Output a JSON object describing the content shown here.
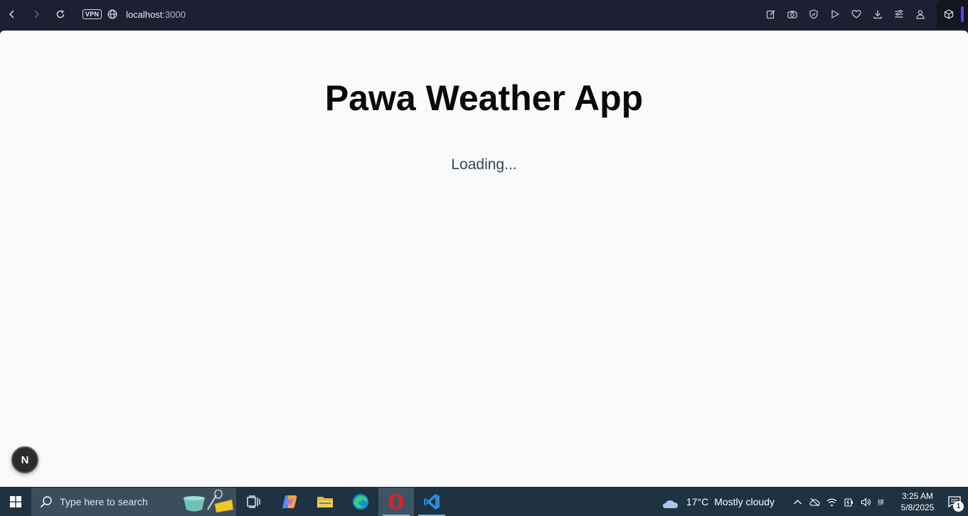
{
  "browser": {
    "vpn_label": "VPN",
    "url_host": "localhost",
    "url_port": ":3000",
    "toolbar_icons": [
      "edit-icon",
      "camera-icon",
      "shield-icon",
      "play-icon",
      "heart-icon",
      "download-icon",
      "menu-icon",
      "profile-icon"
    ],
    "extension_icon": "cube-icon",
    "accent": "#6a3df2"
  },
  "page": {
    "title": "Pawa Weather App",
    "status": "Loading...",
    "dev_badge": "N"
  },
  "taskbar": {
    "search_placeholder": "Type here to search",
    "apps": [
      "task-view-icon",
      "copilot-icon",
      "file-explorer-icon",
      "edge-icon",
      "opera-icon",
      "vscode-icon"
    ],
    "weather": {
      "temp": "17°C",
      "condition": "Mostly cloudy"
    },
    "clock": {
      "time": "3:25 AM",
      "date": "5/8/2025"
    },
    "notification_count": "1"
  }
}
